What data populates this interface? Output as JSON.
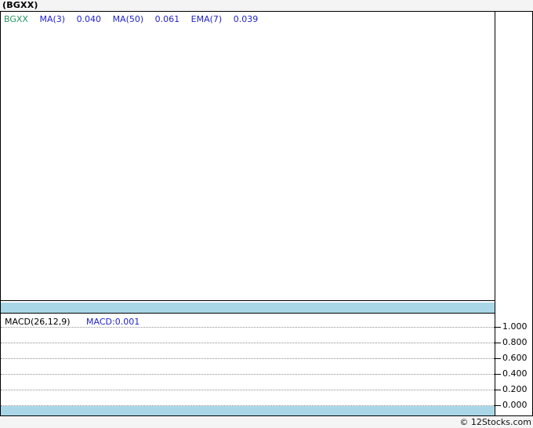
{
  "page": {
    "title": "(BGXX)",
    "copyright": "© 12Stocks.com"
  },
  "colors": {
    "page_bg": "#f4f4f4",
    "panel_bg": "#ffffff",
    "border": "#000000",
    "axis_band": "#a9d7e8",
    "ticker_green": "#289664",
    "indicator_blue": "#2222cc",
    "grid_gray": "#909090"
  },
  "price_panel": {
    "legend": {
      "ticker": "BGXX",
      "ma3_label": "MA(3)",
      "ma3_value": "0.040",
      "ma50_label": "MA(50)",
      "ma50_value": "0.061",
      "ema7_label": "EMA(7)",
      "ema7_value": "0.039"
    }
  },
  "macd_panel": {
    "label": "MACD(26,12,9)",
    "value_label": "MACD:0.001",
    "axis_ticks": [
      "1.000",
      "0.800",
      "0.600",
      "0.400",
      "0.200",
      "0.000"
    ]
  },
  "chart_data": [
    {
      "type": "line",
      "panel": "price",
      "title": "(BGXX)",
      "legend": [
        "BGXX",
        "MA(3) 0.040",
        "MA(50) 0.061",
        "EMA(7) 0.039"
      ],
      "series": [
        {
          "name": "BGXX",
          "values": []
        },
        {
          "name": "MA(3)",
          "last_value": 0.04,
          "values": []
        },
        {
          "name": "MA(50)",
          "last_value": 0.061,
          "values": []
        },
        {
          "name": "EMA(7)",
          "last_value": 0.039,
          "values": []
        }
      ],
      "x": [],
      "y_axis_labels": [],
      "grid": false,
      "legend_position": "top-left",
      "note": "plot area is empty - no visible price bars or indicator lines"
    },
    {
      "type": "line",
      "panel": "macd",
      "legend": [
        "MACD(26,12,9)",
        "MACD:0.001"
      ],
      "series": [
        {
          "name": "MACD",
          "last_value": 0.001,
          "values": []
        }
      ],
      "x": [],
      "ylim": [
        0.0,
        1.0
      ],
      "y_ticks": [
        1.0,
        0.8,
        0.6,
        0.4,
        0.2,
        0.0
      ],
      "grid": true,
      "legend_position": "top-left",
      "note": "only dotted horizontal gridlines visible - no MACD curve drawn"
    }
  ]
}
